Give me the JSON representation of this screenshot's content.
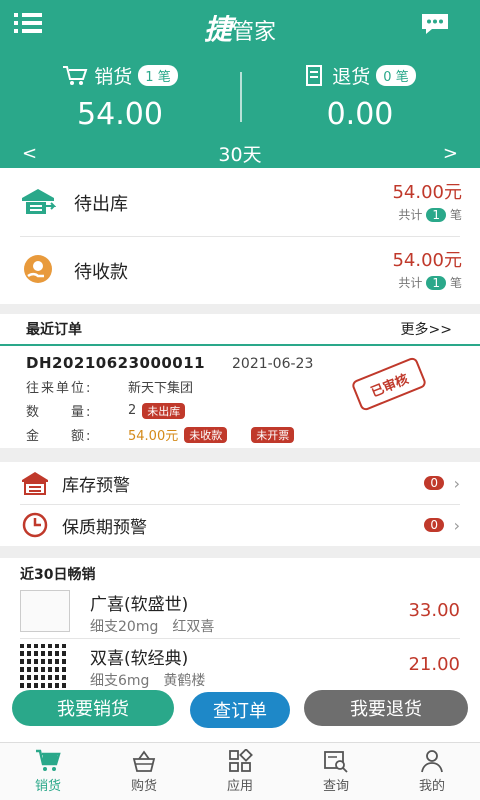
{
  "header": {
    "logo_big": "捷",
    "logo_rest": "管家",
    "sales_label": "销货",
    "sales_count": "1 笔",
    "sales_amount": "54.00",
    "return_label": "退货",
    "return_count": "0 笔",
    "return_amount": "0.00",
    "period": "30天",
    "prev_arrow": "<",
    "next_arrow": ">"
  },
  "pending": [
    {
      "label": "待出库",
      "amount": "54.00元",
      "count_prefix": "共计",
      "count": "1",
      "count_suffix": "笔"
    },
    {
      "label": "待收款",
      "amount": "54.00元",
      "count_prefix": "共计",
      "count": "1",
      "count_suffix": "笔"
    }
  ],
  "recent": {
    "title": "最近订单",
    "more": "更多>>",
    "order_no": "DH20210623000011",
    "date": "2021-06-23",
    "unit_label": "往来单位:",
    "unit_value": "新天下集团",
    "qty_label": "数　　量:",
    "qty_value": "2",
    "qty_tag": "未出库",
    "amt_label": "金　　额:",
    "amt_value": "54.00元",
    "amt_tag1": "未收款",
    "amt_tag2": "未开票",
    "stamp": "已审核"
  },
  "warnings": [
    {
      "label": "库存预警",
      "count": "0"
    },
    {
      "label": "保质期预警",
      "count": "0"
    }
  ],
  "best": {
    "title": "近30日畅销",
    "items": [
      {
        "name": "广喜(软盛世)",
        "spec": "细支20mg　红双喜",
        "price": "33.00"
      },
      {
        "name": "双喜(软经典)",
        "spec": "细支6mg　黄鹤楼",
        "price": "21.00"
      }
    ]
  },
  "actions": {
    "sell": "我要销货",
    "query": "查订单",
    "return": "我要退货"
  },
  "nav": [
    {
      "label": "销货"
    },
    {
      "label": "购货"
    },
    {
      "label": "应用"
    },
    {
      "label": "查询"
    },
    {
      "label": "我的"
    }
  ],
  "colors": {
    "primary": "#2aa88a",
    "accent_red": "#c0392b",
    "blue": "#1e88c8"
  }
}
